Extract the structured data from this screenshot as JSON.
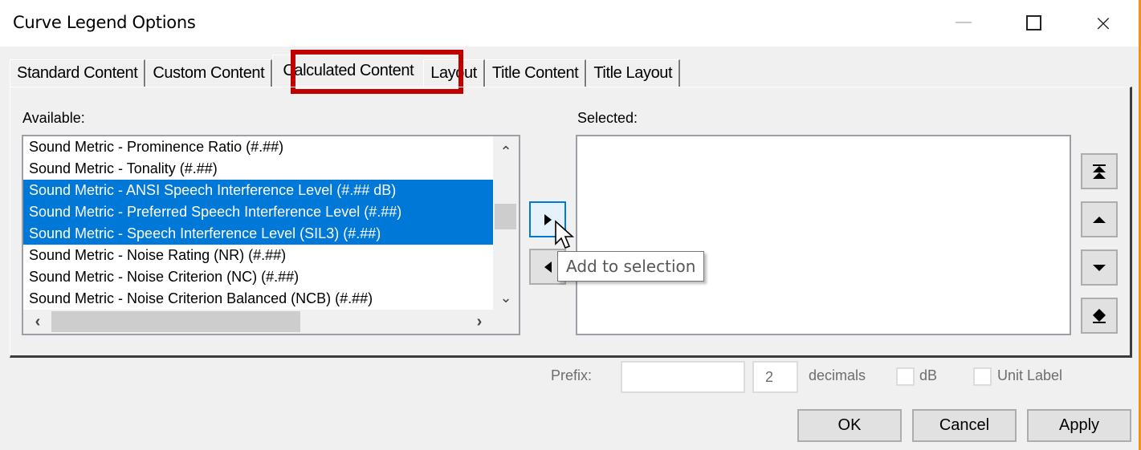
{
  "window": {
    "title": "Curve Legend Options",
    "controls": {
      "minimize": "minimize-icon",
      "maximize": "maximize-icon",
      "close": "×"
    }
  },
  "tabs": [
    {
      "label": "Standard Content",
      "active": false
    },
    {
      "label": "Custom Content",
      "active": false
    },
    {
      "label": "Calculated Content",
      "active": true
    },
    {
      "label": "Layout",
      "active": false
    },
    {
      "label": "Title Content",
      "active": false
    },
    {
      "label": "Title Layout",
      "active": false
    }
  ],
  "highlight_color": "#c00000",
  "available": {
    "label": "Available:",
    "items": [
      {
        "text": "Sound Metric - Prominence Ratio (#.##)",
        "selected": false
      },
      {
        "text": "Sound Metric - Tonality (#.##)",
        "selected": false
      },
      {
        "text": "Sound Metric - ANSI Speech Interference Level (#.## dB)",
        "selected": true
      },
      {
        "text": "Sound Metric - Preferred Speech Interference Level (#.##)",
        "selected": true
      },
      {
        "text": "Sound Metric - Speech Interference Level (SIL3) (#.##)",
        "selected": true
      },
      {
        "text": "Sound Metric - Noise Rating (NR) (#.##)",
        "selected": false
      },
      {
        "text": "Sound Metric - Noise Criterion (NC) (#.##)",
        "selected": false
      },
      {
        "text": "Sound Metric - Noise Criterion Balanced (NCB) (#.##)",
        "selected": false
      }
    ],
    "selection_color": "#0078d7",
    "scroll_up": "^",
    "scroll_down": "v",
    "scroll_left": "<",
    "scroll_right": ">"
  },
  "selected": {
    "label": "Selected:",
    "items": []
  },
  "transfer": {
    "add_icon": "triangle-right",
    "remove_icon": "triangle-left",
    "tooltip": "Add to selection"
  },
  "order_buttons": [
    "move-to-top",
    "move-up",
    "move-down",
    "move-to-bottom"
  ],
  "options": {
    "prefix_label": "Prefix:",
    "prefix_value": "",
    "decimals_value": "2",
    "decimals_label": "decimals",
    "db_label": "dB",
    "db_checked": false,
    "unit_label": "Unit Label",
    "unit_checked": false
  },
  "buttons": {
    "ok": "OK",
    "cancel": "Cancel",
    "apply": "Apply"
  }
}
